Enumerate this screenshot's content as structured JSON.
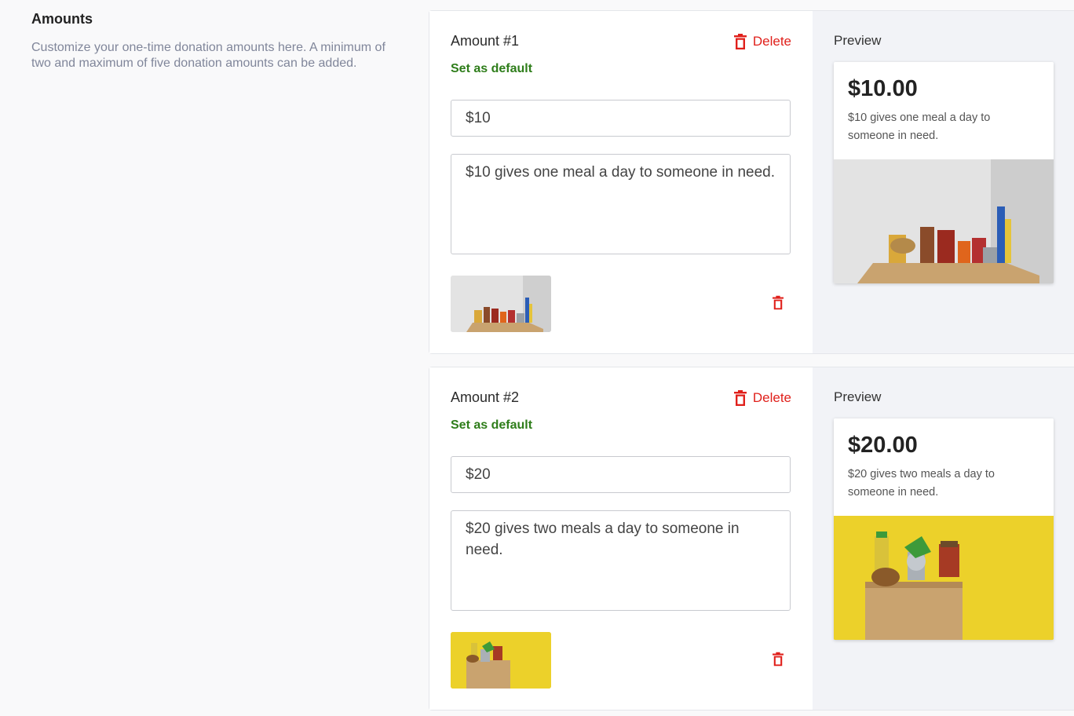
{
  "section": {
    "title": "Amounts",
    "description": "Customize your one-time donation amounts here. A minimum of two and maximum of five donation amounts can be added."
  },
  "amounts": [
    {
      "title": "Amount #1",
      "delete_label": "Delete",
      "set_default_label": "Set as default",
      "amount_value": "$10",
      "description_value": "$10 gives one meal a day to someone in need.",
      "image_name": "grey-food-box-image",
      "preview": {
        "label": "Preview",
        "amount": "$10.00",
        "description": "$10 gives one meal a day to someone in need."
      }
    },
    {
      "title": "Amount #2",
      "delete_label": "Delete",
      "set_default_label": "Set as default",
      "amount_value": "$20",
      "description_value": "$20 gives two meals a day to someone in need.",
      "image_name": "yellow-food-box-image",
      "preview": {
        "label": "Preview",
        "amount": "$20.00",
        "description": "$20 gives two meals a day to someone in need."
      }
    }
  ],
  "colors": {
    "delete": "#e0201b",
    "set_default": "#2e7d1a",
    "preview_bg": "#f2f3f7"
  },
  "icons": {
    "delete": "trash-icon"
  }
}
